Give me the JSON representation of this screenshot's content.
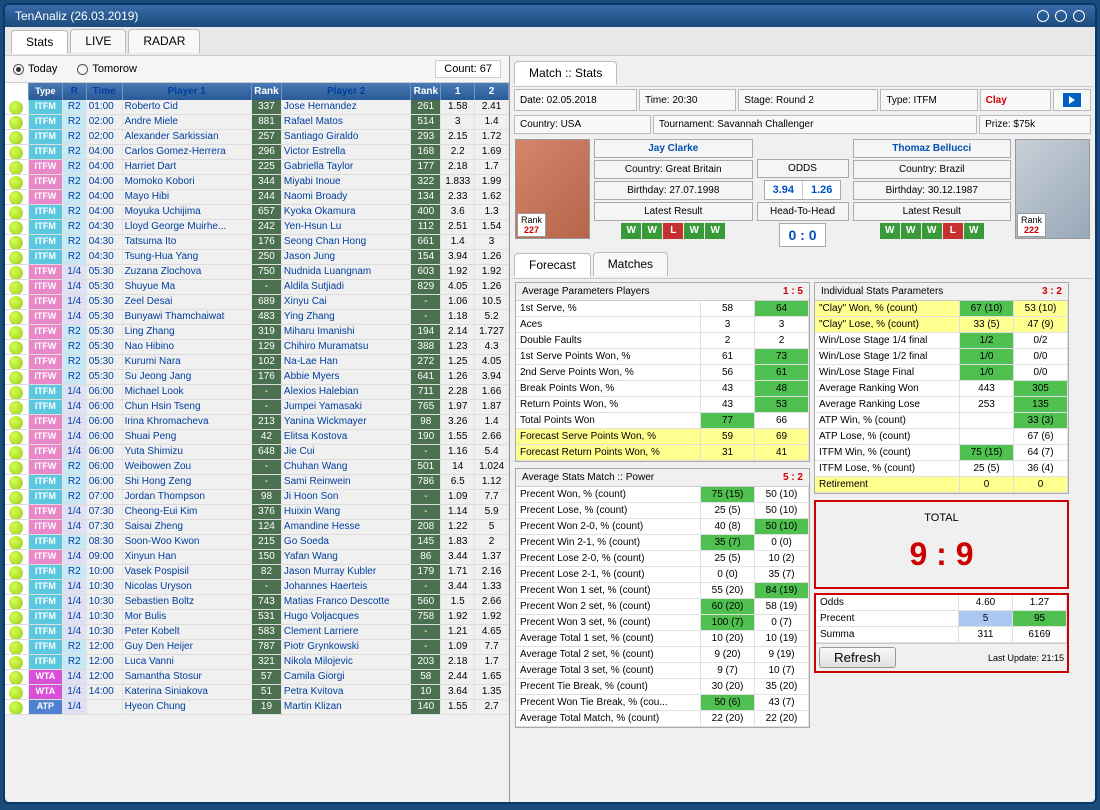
{
  "title": "TenAnaliz (26.03.2019)",
  "mainTabs": [
    "Stats",
    "LIVE",
    "RADAR"
  ],
  "dayRow": {
    "today": "Today",
    "tomorrow": "Tomorow",
    "count": "Count: 67"
  },
  "gridHeaders": [
    "",
    "Type",
    "R",
    "Time",
    "Player 1",
    "Rank",
    "Player 2",
    "Rank",
    "1",
    "2"
  ],
  "rows": [
    {
      "flag": "mx",
      "type": "ITFM",
      "r": "R2",
      "time": "01:00",
      "p1": "Roberto Cid",
      "rk1": "337",
      "p2": "Jose Hernandez",
      "rk2": "261",
      "o1": "1.58",
      "o2": "2.41"
    },
    {
      "flag": "mx",
      "type": "ITFM",
      "r": "R2",
      "time": "02:00",
      "p1": "Andre Miele",
      "rk1": "881",
      "p2": "Rafael Matos",
      "rk2": "514",
      "o1": "3",
      "o2": "1.4"
    },
    {
      "flag": "mx",
      "type": "ITFM",
      "r": "R2",
      "time": "02:00",
      "p1": "Alexander Sarkissian",
      "rk1": "257",
      "p2": "Santiago Giraldo",
      "rk2": "293",
      "o1": "2.15",
      "o2": "1.72"
    },
    {
      "flag": "mx",
      "type": "ITFM",
      "r": "R2",
      "time": "04:00",
      "p1": "Carlos Gomez-Herrera",
      "rk1": "296",
      "p2": "Victor Estrella",
      "rk2": "168",
      "o1": "2.2",
      "o2": "1.69"
    },
    {
      "flag": "jp",
      "type": "ITFW",
      "r": "R2",
      "time": "04:00",
      "p1": "Harriet Dart",
      "rk1": "225",
      "p2": "Gabriella Taylor",
      "rk2": "177",
      "o1": "2.18",
      "o2": "1.7"
    },
    {
      "flag": "jp",
      "type": "ITFW",
      "r": "R2",
      "time": "04:00",
      "p1": "Momoko Kobori",
      "rk1": "344",
      "p2": "Miyabi Inoue",
      "rk2": "322",
      "o1": "1.833",
      "o2": "1.99"
    },
    {
      "flag": "jp",
      "type": "ITFW",
      "r": "R2",
      "time": "04:00",
      "p1": "Mayo Hibi",
      "rk1": "244",
      "p2": "Naomi Broady",
      "rk2": "134",
      "o1": "2.33",
      "o2": "1.62"
    },
    {
      "flag": "jp",
      "type": "ITFM",
      "r": "R2",
      "time": "04:00",
      "p1": "Moyuka Uchijima",
      "rk1": "657",
      "p2": "Kyoka Okamura",
      "rk2": "400",
      "o1": "3.6",
      "o2": "1.3"
    },
    {
      "flag": "kr",
      "type": "ITFM",
      "r": "R2",
      "time": "04:30",
      "p1": "Lloyd George Muirhe...",
      "rk1": "242",
      "p2": "Yen-Hsun Lu",
      "rk2": "112",
      "o1": "2.51",
      "o2": "1.54"
    },
    {
      "flag": "kr",
      "type": "ITFM",
      "r": "R2",
      "time": "04:30",
      "p1": "Tatsuma Ito",
      "rk1": "176",
      "p2": "Seong Chan Hong",
      "rk2": "661",
      "o1": "1.4",
      "o2": "3"
    },
    {
      "flag": "kr",
      "type": "ITFM",
      "r": "R2",
      "time": "04:30",
      "p1": "Tsung-Hua Yang",
      "rk1": "250",
      "p2": "Jason Jung",
      "rk2": "154",
      "o1": "3.94",
      "o2": "1.26"
    },
    {
      "flag": "th",
      "type": "ITFW",
      "r": "1/4",
      "time": "05:30",
      "p1": "Zuzana Zlochova",
      "rk1": "750",
      "p2": "Nudnida Luangnam",
      "rk2": "603",
      "o1": "1.92",
      "o2": "1.92"
    },
    {
      "flag": "cn",
      "type": "ITFW",
      "r": "1/4",
      "time": "05:30",
      "p1": "Shuyue Ma",
      "rk1": "-",
      "p2": "Aldila Sutjiadi",
      "rk2": "829",
      "o1": "4.05",
      "o2": "1.26"
    },
    {
      "flag": "cn",
      "type": "ITFW",
      "r": "1/4",
      "time": "05:30",
      "p1": "Zeel Desai",
      "rk1": "689",
      "p2": "Xinyu Cai",
      "rk2": "-",
      "o1": "1.06",
      "o2": "10.5"
    },
    {
      "flag": "th",
      "type": "ITFW",
      "r": "1/4",
      "time": "05:30",
      "p1": "Bunyawi Thamchaiwat",
      "rk1": "483",
      "p2": "Ying Zhang",
      "rk2": "-",
      "o1": "1.18",
      "o2": "5.2"
    },
    {
      "flag": "jp",
      "type": "ITFW",
      "r": "R2",
      "time": "05:30",
      "p1": "Ling Zhang",
      "rk1": "319",
      "p2": "Miharu Imanishi",
      "rk2": "194",
      "o1": "2.14",
      "o2": "1.727"
    },
    {
      "flag": "jp",
      "type": "ITFW",
      "r": "R2",
      "time": "05:30",
      "p1": "Nao Hibino",
      "rk1": "129",
      "p2": "Chihiro Muramatsu",
      "rk2": "388",
      "o1": "1.23",
      "o2": "4.3"
    },
    {
      "flag": "jp",
      "type": "ITFW",
      "r": "R2",
      "time": "05:30",
      "p1": "Kurumi Nara",
      "rk1": "102",
      "p2": "Na-Lae Han",
      "rk2": "272",
      "o1": "1.25",
      "o2": "4.05"
    },
    {
      "flag": "jp",
      "type": "ITFW",
      "r": "R2",
      "time": "05:30",
      "p1": "Su Jeong Jang",
      "rk1": "176",
      "p2": "Abbie Myers",
      "rk2": "641",
      "o1": "1.26",
      "o2": "3.94"
    },
    {
      "flag": "vn",
      "type": "ITFM",
      "r": "1/4",
      "time": "06:00",
      "p1": "Michael Look",
      "rk1": "-",
      "p2": "Alexios Halebian",
      "rk2": "711",
      "o1": "2.28",
      "o2": "1.66"
    },
    {
      "flag": "cn",
      "type": "ITFM",
      "r": "1/4",
      "time": "06:00",
      "p1": "Chun Hsin Tseng",
      "rk1": "-",
      "p2": "Jumpei Yamasaki",
      "rk2": "765",
      "o1": "1.97",
      "o2": "1.87"
    },
    {
      "flag": "cn",
      "type": "ITFW",
      "r": "1/4",
      "time": "06:00",
      "p1": "Irina Khromacheva",
      "rk1": "213",
      "p2": "Yanina Wickmayer",
      "rk2": "98",
      "o1": "3.26",
      "o2": "1.4"
    },
    {
      "flag": "cn",
      "type": "ITFW",
      "r": "1/4",
      "time": "06:00",
      "p1": "Shuai Peng",
      "rk1": "42",
      "p2": "Elitsa Kostova",
      "rk2": "190",
      "o1": "1.55",
      "o2": "2.66"
    },
    {
      "flag": "cn",
      "type": "ITFW",
      "r": "1/4",
      "time": "06:00",
      "p1": "Yuta Shimizu",
      "rk1": "648",
      "p2": "Jie Cui",
      "rk2": "-",
      "o1": "1.16",
      "o2": "5.4"
    },
    {
      "flag": "cn",
      "type": "ITFW",
      "r": "R2",
      "time": "06:00",
      "p1": "Weibowen Zou",
      "rk1": "-",
      "p2": "Chuhan Wang",
      "rk2": "501",
      "o1": "14",
      "o2": "1.024"
    },
    {
      "flag": "cn",
      "type": "ITFM",
      "r": "R2",
      "time": "06:00",
      "p1": "Shi Hong Zeng",
      "rk1": "-",
      "p2": "Sami Reinwein",
      "rk2": "786",
      "o1": "6.5",
      "o2": "1.12"
    },
    {
      "flag": "kr",
      "type": "ITFM",
      "r": "R2",
      "time": "07:00",
      "p1": "Jordan Thompson",
      "rk1": "98",
      "p2": "Ji Hoon Son",
      "rk2": "-",
      "o1": "1.09",
      "o2": "7.7"
    },
    {
      "flag": "cn",
      "type": "ITFW",
      "r": "1/4",
      "time": "07:30",
      "p1": "Cheong-Eui Kim",
      "rk1": "376",
      "p2": "Huixin Wang",
      "rk2": "-",
      "o1": "1.14",
      "o2": "5.9"
    },
    {
      "flag": "cn",
      "type": "ITFW",
      "r": "1/4",
      "time": "07:30",
      "p1": "Saisai Zheng",
      "rk1": "124",
      "p2": "Amandine Hesse",
      "rk2": "208",
      "o1": "1.22",
      "o2": "5"
    },
    {
      "flag": "kr",
      "type": "ITFM",
      "r": "R2",
      "time": "08:30",
      "p1": "Soon-Woo Kwon",
      "rk1": "215",
      "p2": "Go Soeda",
      "rk2": "145",
      "o1": "1.83",
      "o2": "2"
    },
    {
      "flag": "cn",
      "type": "ITFW",
      "r": "1/4",
      "time": "09:00",
      "p1": "Xinyun Han",
      "rk1": "150",
      "p2": "Yafan Wang",
      "rk2": "86",
      "o1": "3.44",
      "o2": "1.37"
    },
    {
      "flag": "kr",
      "type": "ITFM",
      "r": "R2",
      "time": "10:00",
      "p1": "Vasek Pospisil",
      "rk1": "82",
      "p2": "Jason Murray Kubler",
      "rk2": "179",
      "o1": "1.71",
      "o2": "2.16"
    },
    {
      "flag": "ua",
      "type": "ITFM",
      "r": "1/4",
      "time": "10:30",
      "p1": "Nicolas Uryson",
      "rk1": "-",
      "p2": "Johannes Haerteis",
      "rk2": "-",
      "o1": "3.44",
      "o2": "1.33"
    },
    {
      "flag": "ua",
      "type": "ITFM",
      "r": "1/4",
      "time": "10:30",
      "p1": "Sebastien Boltz",
      "rk1": "743",
      "p2": "Matias Franco Descotte",
      "rk2": "560",
      "o1": "1.5",
      "o2": "2.66"
    },
    {
      "flag": "ua",
      "type": "ITFM",
      "r": "1/4",
      "time": "10:30",
      "p1": "Mor Bulis",
      "rk1": "531",
      "p2": "Hugo Voljacques",
      "rk2": "758",
      "o1": "1.92",
      "o2": "1.92"
    },
    {
      "flag": "ua",
      "type": "ITFM",
      "r": "1/4",
      "time": "10:30",
      "p1": "Peter Kobelt",
      "rk1": "583",
      "p2": "Clement Larriere",
      "rk2": "-",
      "o1": "1.21",
      "o2": "4.65"
    },
    {
      "flag": "qa",
      "type": "ITFM",
      "r": "R2",
      "time": "12:00",
      "p1": "Guy Den Heijer",
      "rk1": "787",
      "p2": "Piotr Grynkowski",
      "rk2": "-",
      "o1": "1.09",
      "o2": "7.7"
    },
    {
      "flag": "fr",
      "type": "ITFM",
      "r": "R2",
      "time": "12:00",
      "p1": "Luca Vanni",
      "rk1": "321",
      "p2": "Nikola Milojevic",
      "rk2": "203",
      "o1": "2.18",
      "o2": "1.7"
    },
    {
      "flag": "b",
      "type": "WTA",
      "r": "1/4",
      "time": "12:00",
      "p1": "Samantha Stosur",
      "rk1": "57",
      "p2": "Camila Giorgi",
      "rk2": "58",
      "o1": "2.44",
      "o2": "1.65"
    },
    {
      "flag": "b",
      "type": "WTA",
      "r": "1/4",
      "time": "14:00",
      "p1": "Katerina Siniakova",
      "rk1": "51",
      "p2": "Petra Kvitova",
      "rk2": "10",
      "o1": "3.64",
      "o2": "1.35"
    },
    {
      "flag": "de",
      "type": "ATP",
      "r": "1/4",
      "time": "",
      "p1": "Hyeon Chung",
      "rk1": "19",
      "p2": "Martin Klizan",
      "rk2": "140",
      "o1": "1.55",
      "o2": "2.7"
    }
  ],
  "matchTab": "Match :: Stats",
  "info1": {
    "date": "Date: 02.05.2018",
    "time": "Time: 20:30",
    "stage": "Stage: Round 2",
    "type": "Type: ITFM",
    "surface": "Clay"
  },
  "info2": {
    "country": "Country: USA",
    "tournament": "Tournament: Savannah Challenger",
    "prize": "Prize: $75k"
  },
  "p1": {
    "name": "Jay Clarke",
    "country": "Country: Great Britain",
    "birthday": "Birthday: 27.07.1998",
    "rank": "227",
    "latest": "Latest Result",
    "results": [
      "W",
      "W",
      "L",
      "W",
      "W"
    ]
  },
  "p2": {
    "name": "Thomaz Bellucci",
    "country": "Country: Brazil",
    "birthday": "Birthday: 30.12.1987",
    "rank": "222",
    "latest": "Latest Result",
    "results": [
      "W",
      "W",
      "W",
      "L",
      "W"
    ]
  },
  "odds": {
    "label": "ODDS",
    "v1": "3.94",
    "v2": "1.26"
  },
  "h2h": {
    "label": "Head-To-Head",
    "score": "0 : 0"
  },
  "rank_label": "Rank",
  "subTabs": [
    "Forecast",
    "Matches"
  ],
  "avgParams": {
    "title": "Average Parameters Players",
    "score": "1 : 5",
    "rows": [
      {
        "l": "1st Serve, %",
        "v1": "58",
        "v2": "64",
        "hl2": true
      },
      {
        "l": "Aces",
        "v1": "3",
        "v2": "3"
      },
      {
        "l": "Double Faults",
        "v1": "2",
        "v2": "2"
      },
      {
        "l": "1st Serve Points Won, %",
        "v1": "61",
        "v2": "73",
        "hl2": true
      },
      {
        "l": "2nd Serve Points Won, %",
        "v1": "56",
        "v2": "61",
        "hl2": true
      },
      {
        "l": "Break Points Won, %",
        "v1": "43",
        "v2": "48",
        "hl2": true
      },
      {
        "l": "Return Points Won, %",
        "v1": "43",
        "v2": "53",
        "hl2": true
      },
      {
        "l": "Total Points Won",
        "v1": "77",
        "v2": "66",
        "hl1": true
      },
      {
        "l": "Forecast Serve Points Won, %",
        "v1": "59",
        "v2": "69",
        "yl": true
      },
      {
        "l": "Forecast Return Points Won, %",
        "v1": "31",
        "v2": "41",
        "yl": true
      }
    ]
  },
  "avgStats": {
    "title": "Average Stats Match :: Power",
    "score": "5 : 2",
    "rows": [
      {
        "l": "Precent Won, % (count)",
        "v1": "75 (15)",
        "v2": "50 (10)",
        "hl1": true
      },
      {
        "l": "Precent Lose, % (count)",
        "v1": "25 (5)",
        "v2": "50 (10)"
      },
      {
        "l": "Precent Won 2-0, % (count)",
        "v1": "40 (8)",
        "v2": "50 (10)",
        "hl2": true
      },
      {
        "l": "Precent Win 2-1, % (count)",
        "v1": "35 (7)",
        "v2": "0 (0)",
        "hl1": true
      },
      {
        "l": "Precent Lose 2-0, % (count)",
        "v1": "25 (5)",
        "v2": "10 (2)"
      },
      {
        "l": "Precent Lose 2-1, % (count)",
        "v1": "0 (0)",
        "v2": "35 (7)"
      },
      {
        "l": "Precent Won 1 set, % (count)",
        "v1": "55 (20)",
        "v2": "84 (19)",
        "hl2": true
      },
      {
        "l": "Precent Won 2 set, % (count)",
        "v1": "60 (20)",
        "v2": "58 (19)",
        "hl1": true
      },
      {
        "l": "Precent Won 3 set, % (count)",
        "v1": "100 (7)",
        "v2": "0 (7)",
        "hl1": true
      },
      {
        "l": "Average Total 1 set, % (count)",
        "v1": "10 (20)",
        "v2": "10 (19)"
      },
      {
        "l": "Average Total 2 set, % (count)",
        "v1": "9 (20)",
        "v2": "9 (19)"
      },
      {
        "l": "Average Total 3 set, % (count)",
        "v1": "9 (7)",
        "v2": "10 (7)"
      },
      {
        "l": "Precent Tie Break, % (count)",
        "v1": "30 (20)",
        "v2": "35 (20)"
      },
      {
        "l": "Precent Won Tie Break, % (cou...",
        "v1": "50 (6)",
        "v2": "43 (7)",
        "hl1": true
      },
      {
        "l": "Average Total Match, % (count)",
        "v1": "22 (20)",
        "v2": "22 (20)"
      }
    ]
  },
  "indStats": {
    "title": "Individual Stats Parameters",
    "score": "3 : 2",
    "rows": [
      {
        "l": "\"Clay\" Won, % (count)",
        "v1": "67 (10)",
        "v2": "53 (10)",
        "hl1": true,
        "yl": true
      },
      {
        "l": "\"Clay\" Lose, % (count)",
        "v1": "33 (5)",
        "v2": "47 (9)",
        "yl": true
      },
      {
        "l": "Win/Lose Stage 1/4 final",
        "v1": "1/2",
        "v2": "0/2",
        "hl1": true
      },
      {
        "l": "Win/Lose Stage 1/2 final",
        "v1": "1/0",
        "v2": "0/0",
        "hl1": true
      },
      {
        "l": "Win/Lose Stage Final",
        "v1": "1/0",
        "v2": "0/0",
        "hl1": true
      },
      {
        "l": "Average Ranking Won",
        "v1": "443",
        "v2": "305",
        "hl2": true
      },
      {
        "l": "Average Ranking Lose",
        "v1": "253",
        "v2": "135",
        "hl2": true
      },
      {
        "l": "ATP Win, % (count)",
        "v1": "",
        "v2": "33 (3)",
        "hl2": true
      },
      {
        "l": "ATP Lose, % (count)",
        "v1": "",
        "v2": "67 (6)"
      },
      {
        "l": "ITFM Win, % (count)",
        "v1": "75 (15)",
        "v2": "64 (7)",
        "hl1": true
      },
      {
        "l": "ITFM Lose, % (count)",
        "v1": "25 (5)",
        "v2": "36 (4)"
      },
      {
        "l": "Retirement",
        "v1": "0",
        "v2": "0",
        "yl": true
      }
    ]
  },
  "total": {
    "label": "TOTAL",
    "score": "9 : 9"
  },
  "finalTable": {
    "rows": [
      {
        "l": "Odds",
        "v1": "4.60",
        "v2": "1.27"
      },
      {
        "l": "Precent",
        "v1": "5",
        "v2": "95",
        "hl2": true,
        "bl1": true
      },
      {
        "l": "Summa",
        "v1": "311",
        "v2": "6169"
      }
    ],
    "refresh": "Refresh",
    "update": "Last Update: 21:15"
  }
}
